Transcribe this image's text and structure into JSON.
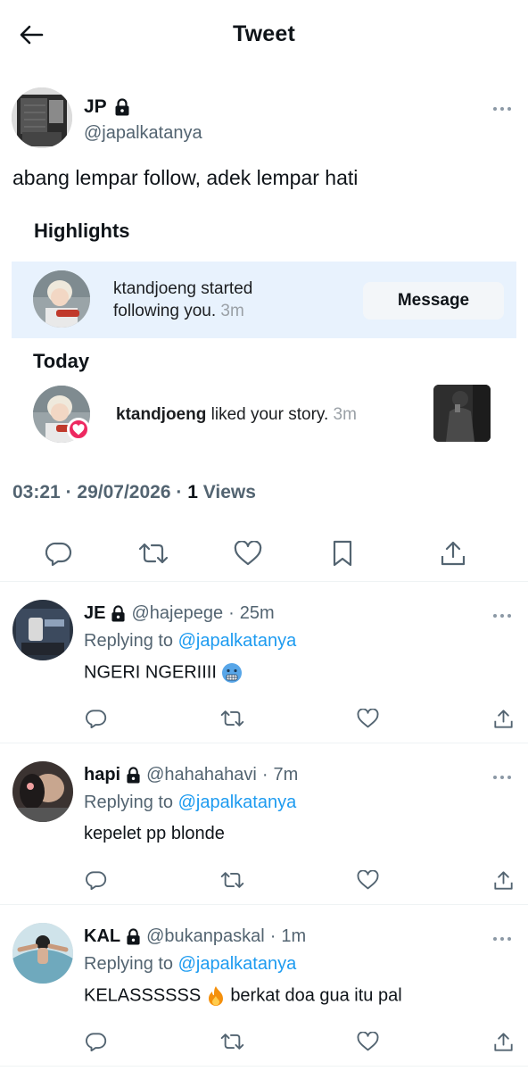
{
  "header": {
    "title": "Tweet"
  },
  "tweet": {
    "author_name": "JP",
    "author_handle": "@japalkatanya",
    "text": "abang lempar follow, adek lempar hati",
    "attachment": {
      "highlights_heading": "Highlights",
      "highlight_user": "ktandjoeng",
      "highlight_action": " started",
      "highlight_action_line2": "following you.",
      "highlight_time": "3m",
      "message_button": "Message",
      "today_heading": "Today",
      "today_user": "ktandjoeng",
      "today_action": " liked your story.",
      "today_time": "3m"
    },
    "time": "03:21",
    "separator": "·",
    "date": "29/07/2026",
    "views_count": "1",
    "views_label": "Views"
  },
  "replies": [
    {
      "name": "JE",
      "handle": "@hajepege",
      "time": "25m",
      "replying_prefix": "Replying to",
      "replying_to": "@japalkatanya",
      "text": "NGERI NGERIIII",
      "emoji": "cold-face"
    },
    {
      "name": "hapi",
      "handle": "@hahahahavi",
      "time": "7m",
      "replying_prefix": "Replying to",
      "replying_to": "@japalkatanya",
      "text": "kepelet pp blonde"
    },
    {
      "name": "KAL",
      "handle": "@bukanpaskal",
      "time": "1m",
      "replying_prefix": "Replying to",
      "replying_to": "@japalkatanya",
      "text_before": "KELASSSSSS",
      "emoji": "fire",
      "text_after": " berkat doa gua itu pal"
    }
  ],
  "colors": {
    "text": "#0f1419",
    "secondary": "#536471",
    "link": "#1d9bf0",
    "highlight_bg": "#e8f2fd",
    "heart_badge": "#ed2860"
  }
}
